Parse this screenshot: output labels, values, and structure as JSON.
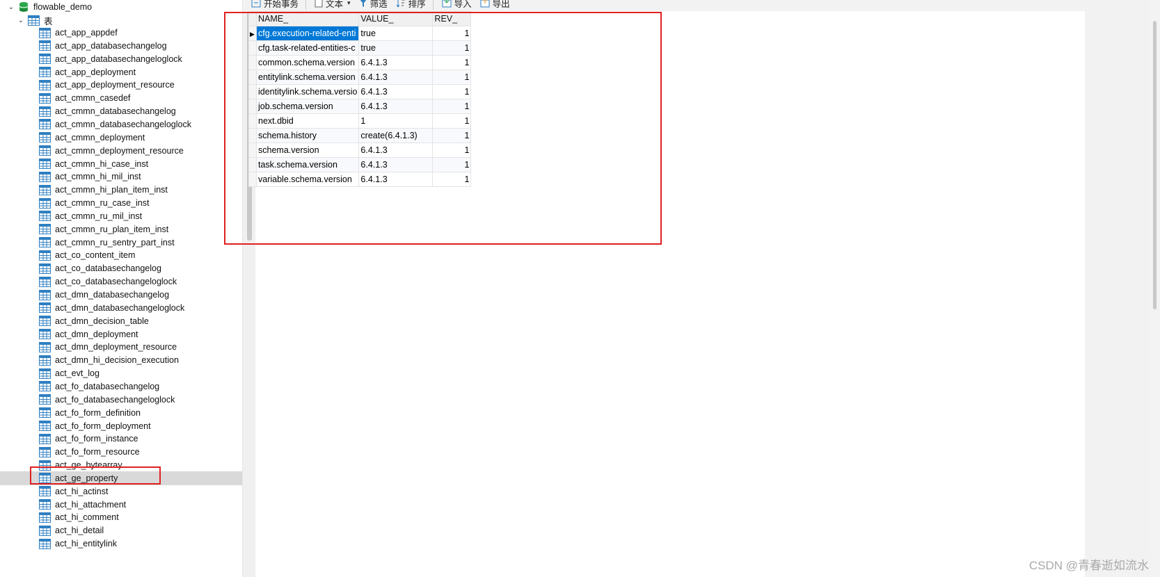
{
  "tree": {
    "database": "flowable_demo",
    "folder": "表",
    "tables": [
      "act_app_appdef",
      "act_app_databasechangelog",
      "act_app_databasechangeloglock",
      "act_app_deployment",
      "act_app_deployment_resource",
      "act_cmmn_casedef",
      "act_cmmn_databasechangelog",
      "act_cmmn_databasechangeloglock",
      "act_cmmn_deployment",
      "act_cmmn_deployment_resource",
      "act_cmmn_hi_case_inst",
      "act_cmmn_hi_mil_inst",
      "act_cmmn_hi_plan_item_inst",
      "act_cmmn_ru_case_inst",
      "act_cmmn_ru_mil_inst",
      "act_cmmn_ru_plan_item_inst",
      "act_cmmn_ru_sentry_part_inst",
      "act_co_content_item",
      "act_co_databasechangelog",
      "act_co_databasechangeloglock",
      "act_dmn_databasechangelog",
      "act_dmn_databasechangeloglock",
      "act_dmn_decision_table",
      "act_dmn_deployment",
      "act_dmn_deployment_resource",
      "act_dmn_hi_decision_execution",
      "act_evt_log",
      "act_fo_databasechangelog",
      "act_fo_databasechangeloglock",
      "act_fo_form_definition",
      "act_fo_form_deployment",
      "act_fo_form_instance",
      "act_fo_form_resource",
      "act_ge_bytearray",
      "act_ge_property",
      "act_hi_actinst",
      "act_hi_attachment",
      "act_hi_comment",
      "act_hi_detail",
      "act_hi_entitylink"
    ],
    "selected_table": "act_ge_property"
  },
  "toolbar": {
    "begin_transaction": "开始事务",
    "text": "文本",
    "filter": "筛选",
    "sort": "排序",
    "import": "导入",
    "export": "导出"
  },
  "grid": {
    "columns": [
      "NAME_",
      "VALUE_",
      "REV_"
    ],
    "rows": [
      {
        "name": "cfg.execution-related-enti",
        "value": "true",
        "rev": "1"
      },
      {
        "name": "cfg.task-related-entities-c",
        "value": "true",
        "rev": "1"
      },
      {
        "name": "common.schema.version",
        "value": "6.4.1.3",
        "rev": "1"
      },
      {
        "name": "entitylink.schema.version",
        "value": "6.4.1.3",
        "rev": "1"
      },
      {
        "name": "identitylink.schema.versio",
        "value": "6.4.1.3",
        "rev": "1"
      },
      {
        "name": "job.schema.version",
        "value": "6.4.1.3",
        "rev": "1"
      },
      {
        "name": "next.dbid",
        "value": "1",
        "rev": "1"
      },
      {
        "name": "schema.history",
        "value": "create(6.4.1.3)",
        "rev": "1"
      },
      {
        "name": "schema.version",
        "value": "6.4.1.3",
        "rev": "1"
      },
      {
        "name": "task.schema.version",
        "value": "6.4.1.3",
        "rev": "1"
      },
      {
        "name": "variable.schema.version",
        "value": "6.4.1.3",
        "rev": "1"
      }
    ]
  },
  "watermark": "CSDN @青春逝如流水",
  "colors": {
    "selection": "#0078d7",
    "highlight_box": "#e02020"
  }
}
